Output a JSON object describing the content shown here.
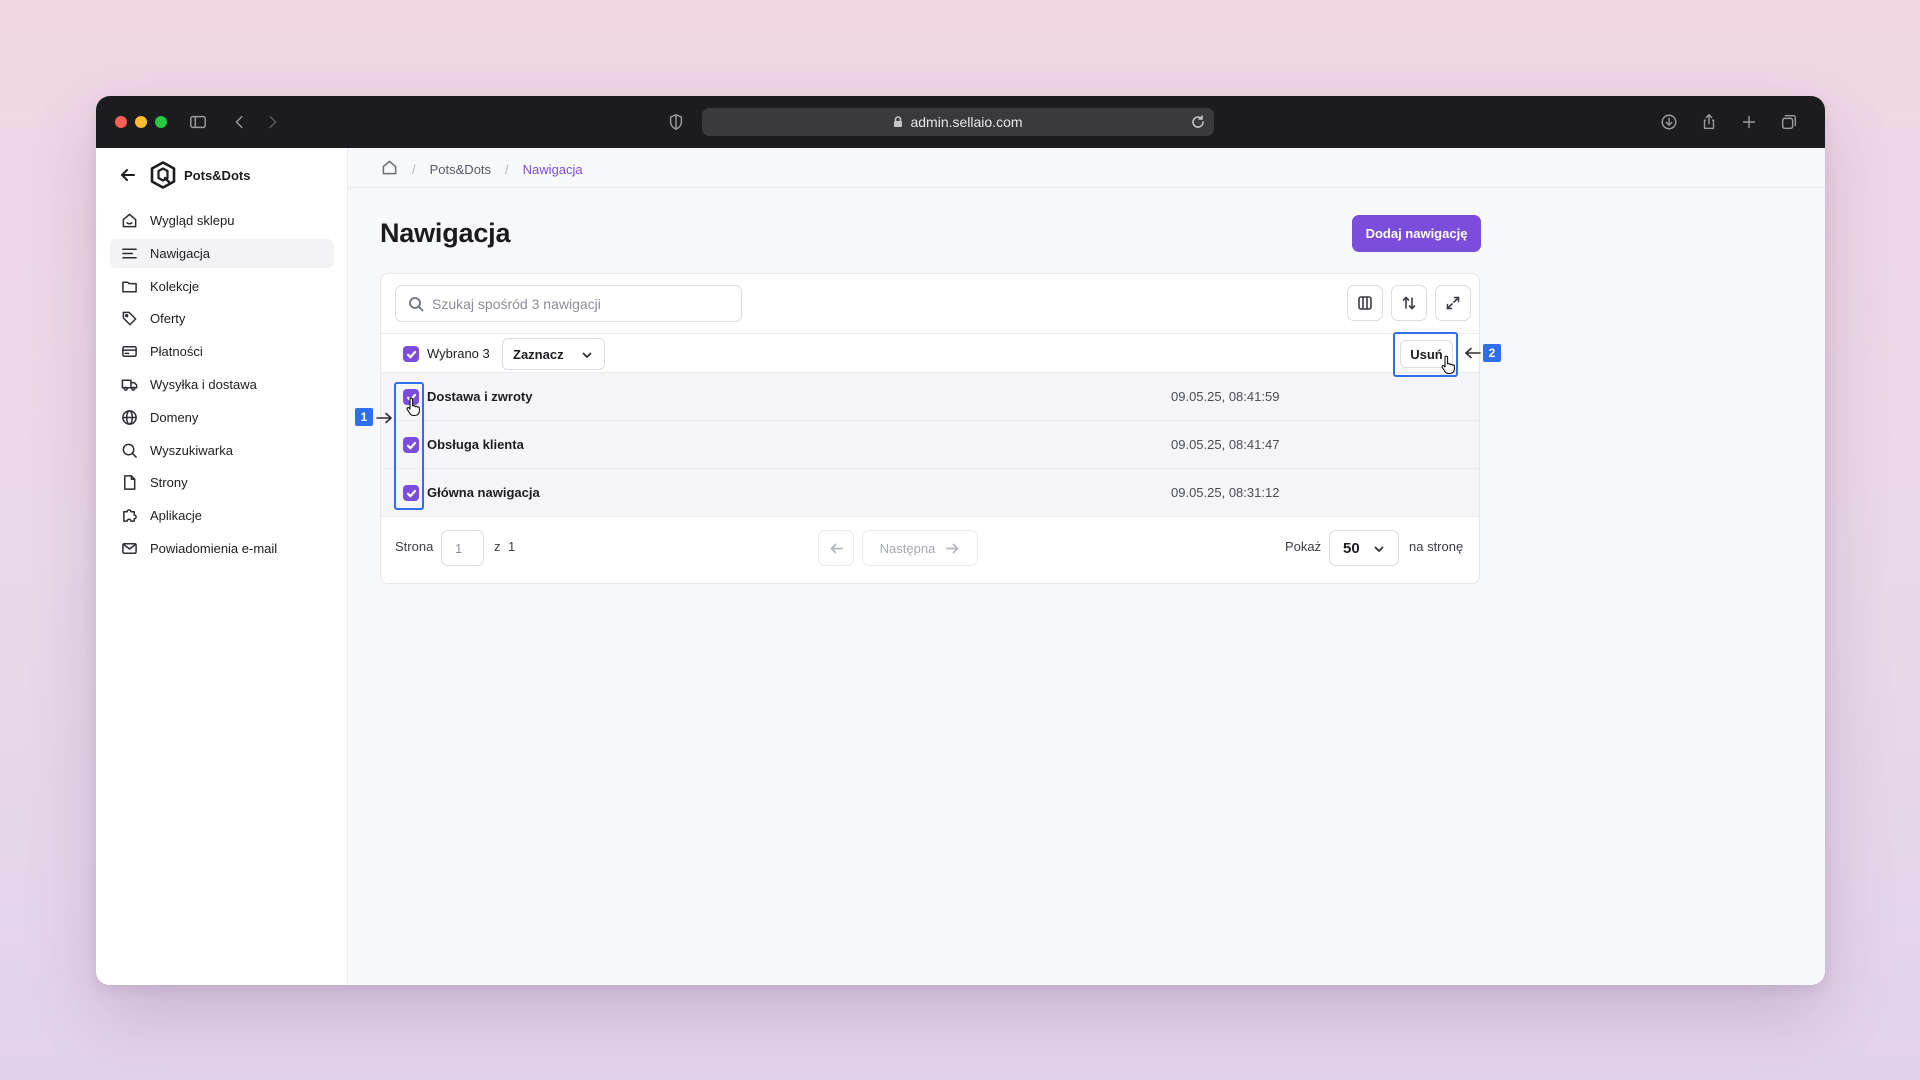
{
  "browser": {
    "url": "admin.sellaio.com"
  },
  "sidebar": {
    "store_name": "Pots&Dots",
    "items": [
      {
        "label": "Wygląd sklepu",
        "icon": "storefront-icon"
      },
      {
        "label": "Nawigacja",
        "icon": "menu-lines-icon",
        "active": true
      },
      {
        "label": "Kolekcje",
        "icon": "folder-icon"
      },
      {
        "label": "Oferty",
        "icon": "tag-icon"
      },
      {
        "label": "Płatności",
        "icon": "credit-card-icon"
      },
      {
        "label": "Wysyłka i dostawa",
        "icon": "truck-icon"
      },
      {
        "label": "Domeny",
        "icon": "globe-icon"
      },
      {
        "label": "Wyszukiwarka",
        "icon": "search-icon"
      },
      {
        "label": "Strony",
        "icon": "page-icon"
      },
      {
        "label": "Aplikacje",
        "icon": "puzzle-icon"
      },
      {
        "label": "Powiadomienia e-mail",
        "icon": "mail-icon"
      }
    ]
  },
  "breadcrumb": {
    "store": "Pots&Dots",
    "current": "Nawigacja"
  },
  "page": {
    "title": "Nawigacja",
    "add_button": "Dodaj nawigację"
  },
  "toolbar": {
    "search_placeholder": "Szukaj spośród 3 nawigacji"
  },
  "bulk": {
    "selected_label": "Wybrano 3",
    "select_dropdown": "Zaznacz",
    "delete_button": "Usuń"
  },
  "rows": [
    {
      "title": "Dostawa i zwroty",
      "date": "09.05.25, 08:41:59",
      "checked": true
    },
    {
      "title": "Obsługa klienta",
      "date": "09.05.25, 08:41:47",
      "checked": true
    },
    {
      "title": "Główna nawigacja",
      "date": "09.05.25, 08:31:12",
      "checked": true
    }
  ],
  "pagination": {
    "page_label": "Strona",
    "page_value": "1",
    "of_label": "z",
    "total_pages": "1",
    "next_label": "Następna",
    "show_label": "Pokaż",
    "per_page": "50",
    "per_page_suffix": "na stronę"
  },
  "annotations": {
    "step1": "1",
    "step2": "2"
  },
  "colors": {
    "accent": "#7c4ddb",
    "annotation": "#2f6fed",
    "chat": "#1a56db"
  }
}
